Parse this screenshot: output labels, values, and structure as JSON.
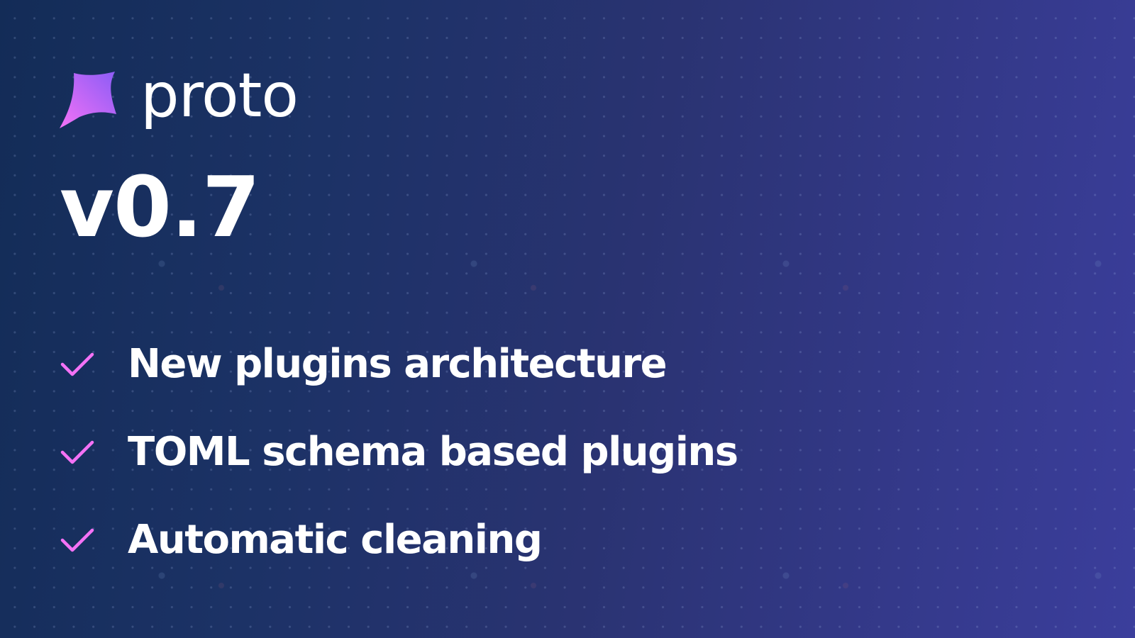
{
  "brand": {
    "logo_icon": "star-icon",
    "name": "proto"
  },
  "version": "v0.7",
  "features": [
    {
      "icon": "check-icon",
      "label": "New plugins architecture"
    },
    {
      "icon": "check-icon",
      "label": "TOML schema based plugins"
    },
    {
      "icon": "check-icon",
      "label": "Automatic cleaning"
    }
  ],
  "colors": {
    "background_start": "#132c57",
    "background_end": "#3b3e9c",
    "accent_pink": "#f472f6",
    "accent_purple": "#8b5cf6",
    "text": "#ffffff"
  }
}
